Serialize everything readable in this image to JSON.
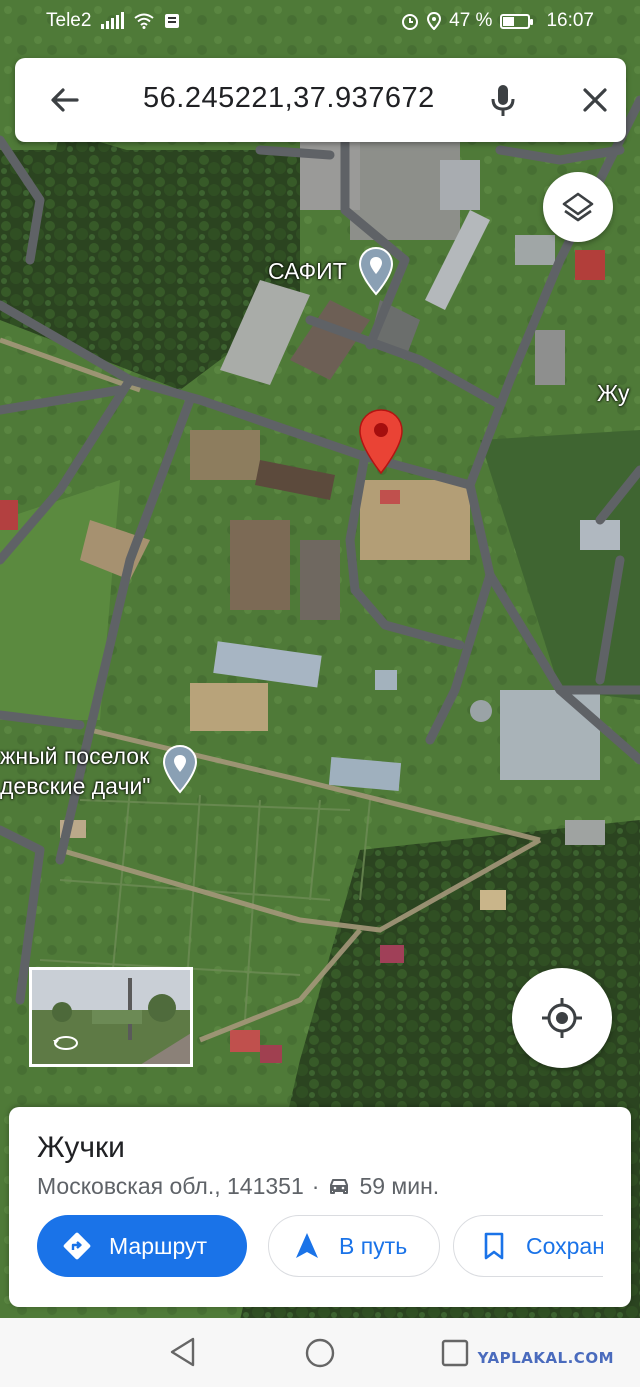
{
  "status_bar": {
    "carrier": "Tele2",
    "battery": "47 %",
    "battery_level": 0.47,
    "time": "16:07"
  },
  "search": {
    "query": "56.245221,37.937672",
    "back_icon": "arrow-back-icon",
    "mic_icon": "mic-icon",
    "close_icon": "close-icon"
  },
  "map": {
    "labels": {
      "safit": "САФИТ",
      "zhu": "Жу",
      "village_line1": "жный поселок",
      "village_line2": "девские дачи\""
    },
    "pin_color": "#ea4335",
    "layers_icon": "layers-icon",
    "locate_icon": "my-location-icon"
  },
  "place": {
    "name": "Жучки",
    "address": "Московская обл., 141351",
    "separator": "·",
    "drive_time": "59 мин.",
    "actions": {
      "route": "Маршрут",
      "start": "В путь",
      "save": "Сохран"
    },
    "accent": "#1a73e8"
  },
  "watermark": "YAPLAKAL.COM"
}
